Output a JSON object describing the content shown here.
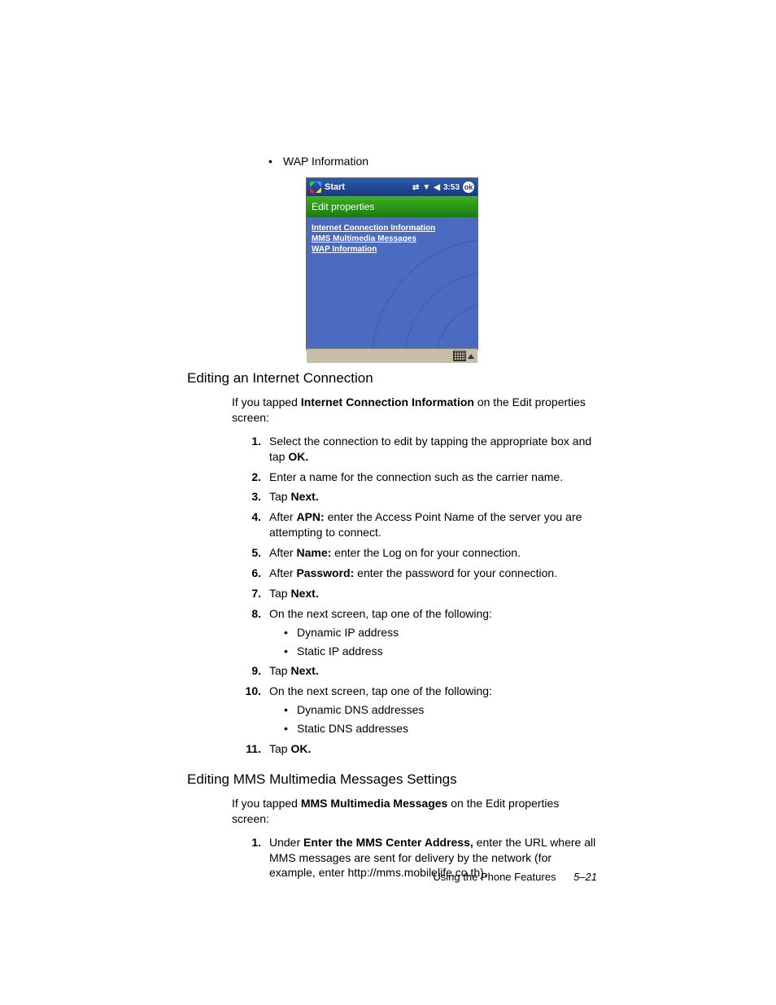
{
  "top_bullet": "WAP Information",
  "screenshot": {
    "start": "Start",
    "time": "3:53",
    "ok": "ok",
    "subbar": "Edit properties",
    "link1": "Internet Connection Information",
    "link2": "MMS Multimedia Messages",
    "link3": "WAP Information"
  },
  "section1": {
    "title": "Editing an Internet Connection",
    "intro_pre": "If you tapped ",
    "intro_bold": "Internet Connection Information",
    "intro_post": " on the Edit properties screen:",
    "steps": [
      {
        "n": "1.",
        "parts": [
          "Select the connection to edit by tapping the appropriate box and tap ",
          "OK.",
          ""
        ]
      },
      {
        "n": "2.",
        "parts": [
          "Enter a name for the connection such as the carrier name.",
          "",
          ""
        ]
      },
      {
        "n": "3.",
        "parts": [
          "Tap ",
          "Next.",
          ""
        ]
      },
      {
        "n": "4.",
        "parts": [
          "After ",
          "APN:",
          " enter the Access Point Name of the server you are attempting to connect."
        ]
      },
      {
        "n": "5.",
        "parts": [
          "After ",
          "Name:",
          " enter the Log on for your connection."
        ]
      },
      {
        "n": "6.",
        "parts": [
          "After ",
          "Password:",
          " enter the password for your connection."
        ]
      },
      {
        "n": "7.",
        "parts": [
          "Tap ",
          "Next.",
          ""
        ]
      },
      {
        "n": "8.",
        "parts": [
          "On the next screen, tap one of the following:",
          "",
          ""
        ],
        "subs": [
          "Dynamic IP address",
          "Static IP address"
        ]
      },
      {
        "n": "9.",
        "parts": [
          "Tap ",
          "Next.",
          ""
        ]
      },
      {
        "n": "10.",
        "parts": [
          "On the next screen, tap one of the following:",
          "",
          ""
        ],
        "subs": [
          "Dynamic DNS addresses",
          "Static DNS addresses"
        ]
      },
      {
        "n": "11.",
        "parts": [
          "Tap ",
          "OK.",
          ""
        ]
      }
    ]
  },
  "section2": {
    "title": "Editing MMS Multimedia Messages Settings",
    "intro_pre": "If you tapped ",
    "intro_bold": "MMS Multimedia Messages",
    "intro_post": " on the Edit properties screen:",
    "steps": [
      {
        "n": "1.",
        "parts": [
          "Under ",
          "Enter the MMS Center Address,",
          " enter the URL where all MMS messages are sent for delivery by the network (for example, enter http://mms.mobilelife.co.th)."
        ]
      }
    ]
  },
  "footer": {
    "label": "Using the Phone Features",
    "page": "5–21"
  }
}
